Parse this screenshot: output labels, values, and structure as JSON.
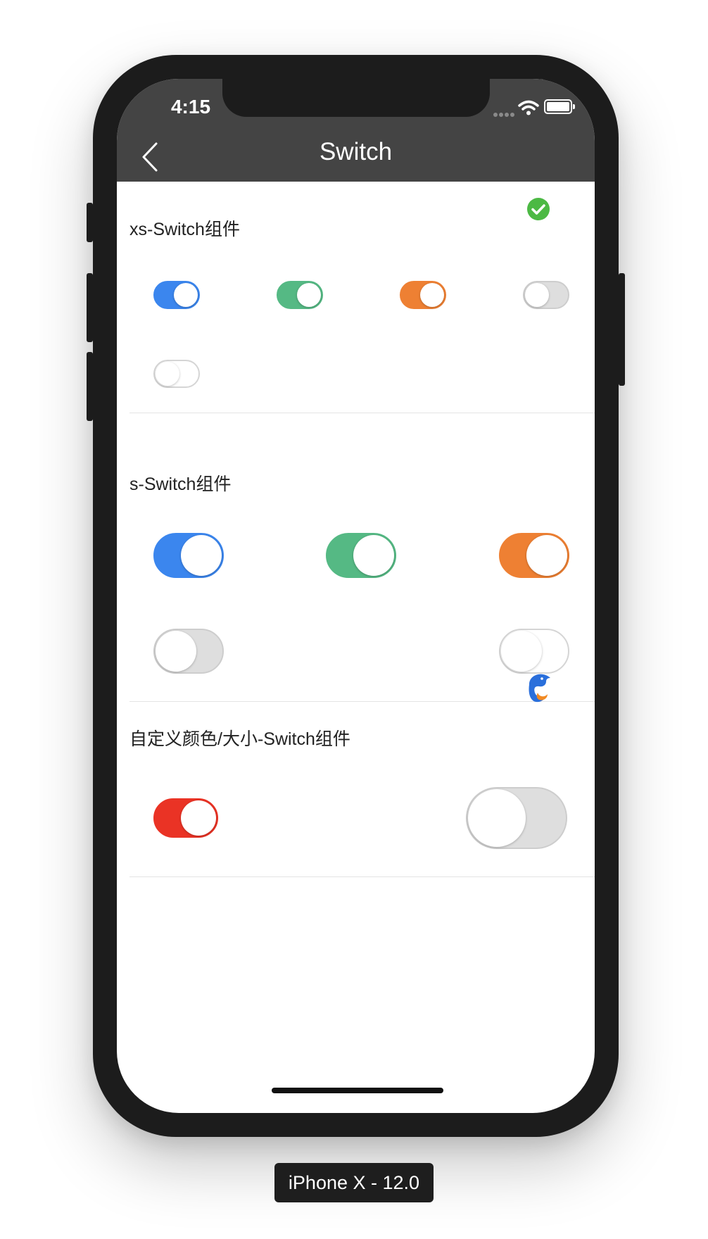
{
  "status_bar": {
    "time": "4:15",
    "signal_icon": "signal-dots-icon",
    "wifi_icon": "wifi-icon",
    "battery_icon": "battery-icon"
  },
  "navbar": {
    "title": "Switch",
    "back_icon": "chevron-left-icon"
  },
  "sections": [
    {
      "title": "xs-Switch组件",
      "badge_icon": "check-circle-icon",
      "switches": [
        {
          "size": "xs",
          "state": "on",
          "color": "#3b86ee"
        },
        {
          "size": "xs",
          "state": "on",
          "color": "#55b984"
        },
        {
          "size": "xs",
          "state": "on",
          "color": "#ee8033"
        },
        {
          "size": "xs",
          "state": "off",
          "color": "#dedede"
        },
        {
          "size": "xs",
          "state": "off",
          "color": "#ffffff"
        }
      ]
    },
    {
      "title": "s-Switch组件",
      "badge_icon": "dolphin-logo-icon",
      "switches": [
        {
          "size": "s",
          "state": "on",
          "color": "#3b86ee"
        },
        {
          "size": "s",
          "state": "on",
          "color": "#55b984"
        },
        {
          "size": "s",
          "state": "on",
          "color": "#ee8033"
        },
        {
          "size": "s",
          "state": "off",
          "color": "#dedede"
        },
        {
          "size": "s",
          "state": "off",
          "color": "#ffffff"
        }
      ]
    },
    {
      "title": "自定义颜色/大小-Switch组件",
      "switches": [
        {
          "size": "custom",
          "state": "on",
          "color": "#ea3325"
        },
        {
          "size": "custom-large",
          "state": "off",
          "color": "#dedede"
        }
      ]
    }
  ],
  "device_label": "iPhone X - 12.0"
}
